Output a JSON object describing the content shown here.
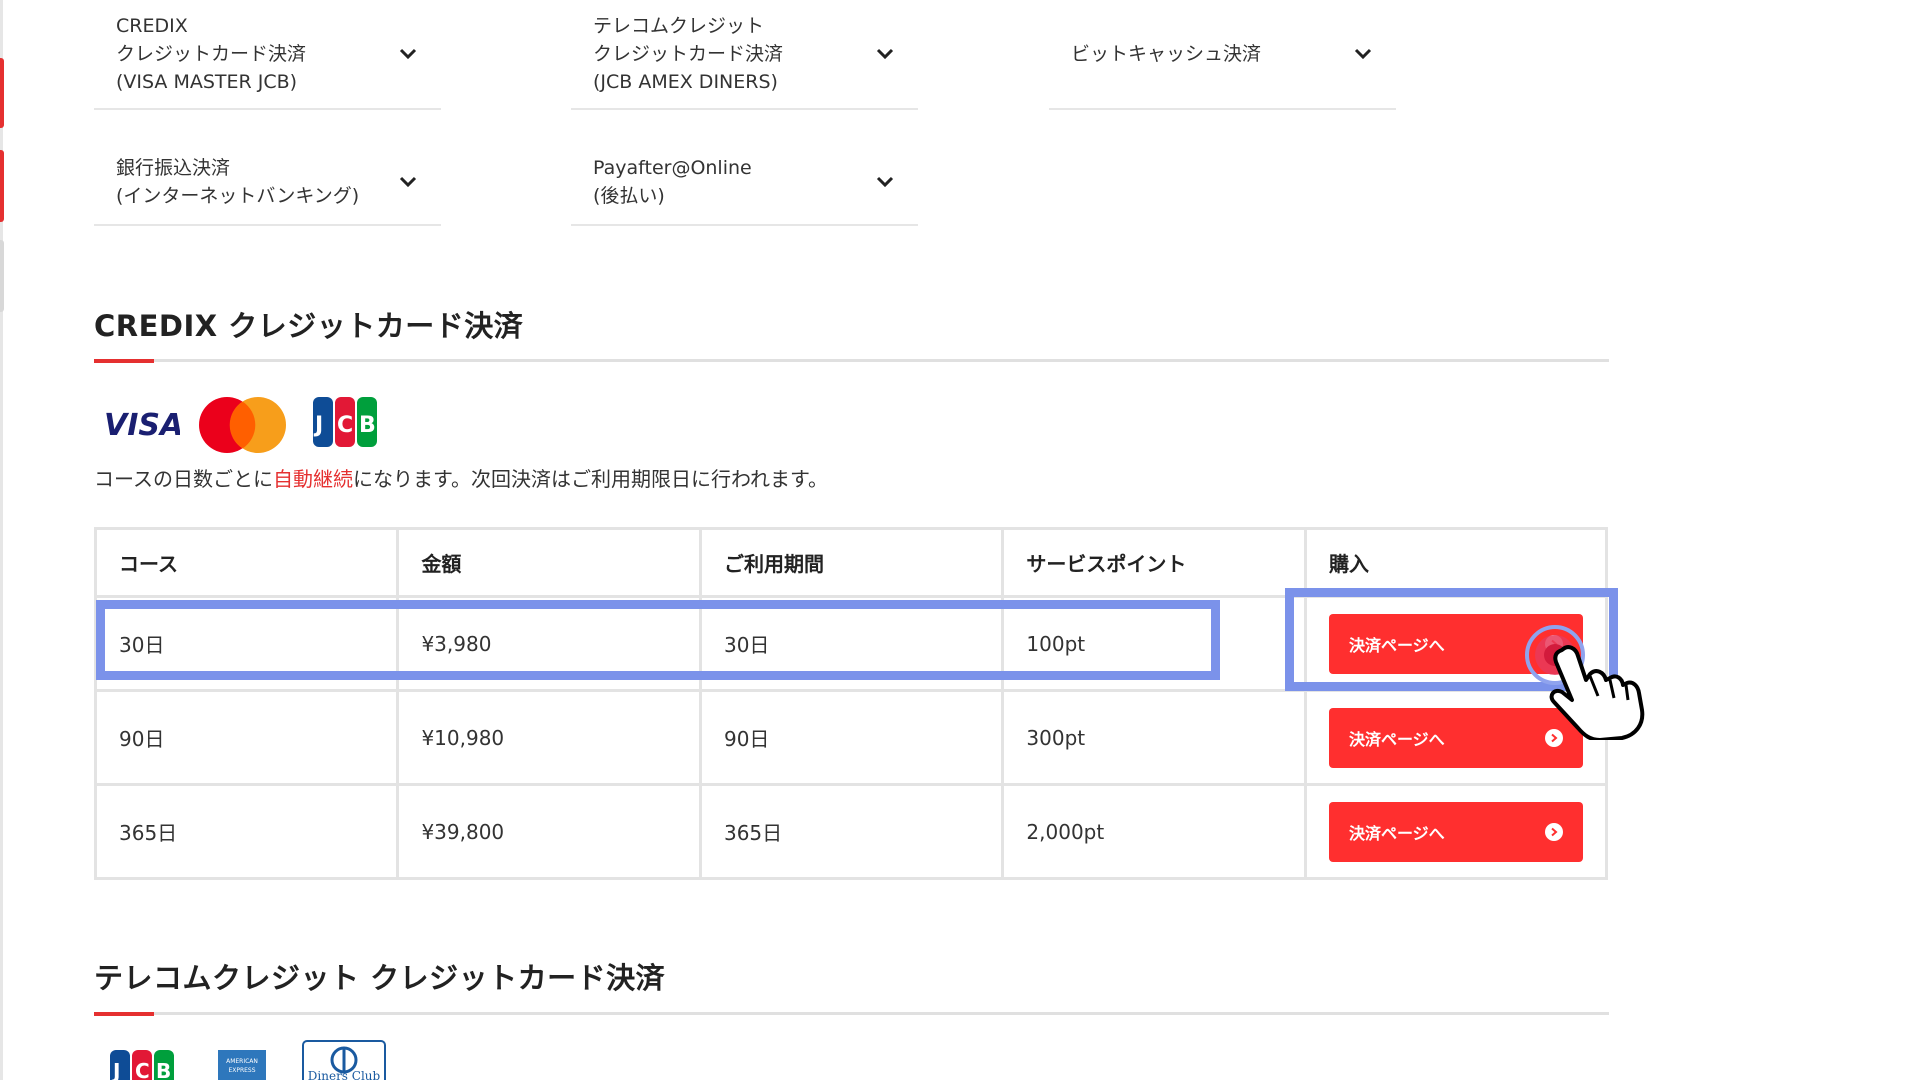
{
  "accordion": [
    {
      "label": "CREDIX\nクレジットカード決済\n(VISA MASTER JCB)"
    },
    {
      "label": "テレコムクレジット\nクレジットカード決済\n(JCB AMEX DINERS)"
    },
    {
      "label": "ビットキャッシュ決済"
    },
    {
      "label": "銀行振込決済\n(インターネットバンキング)"
    },
    {
      "label": "Payafter@Online\n(後払い)"
    }
  ],
  "credix": {
    "title": "CREDIX クレジットカード決済",
    "logos": [
      "VISA",
      "Mastercard",
      "JCB"
    ],
    "note_before": "コースの日数ごとに",
    "note_highlight": "自動継続",
    "note_after": "になります。次回決済はご利用期限日に行われます。",
    "table": {
      "headers": [
        "コース",
        "金額",
        "ご利用期間",
        "サービスポイント",
        "購入"
      ],
      "rows": [
        {
          "course": "30日",
          "price": "¥3,980",
          "period": "30日",
          "points": "100pt",
          "button": "決済ページへ"
        },
        {
          "course": "90日",
          "price": "¥10,980",
          "period": "90日",
          "points": "300pt",
          "button": "決済ページへ"
        },
        {
          "course": "365日",
          "price": "¥39,800",
          "period": "365日",
          "points": "2,000pt",
          "button": "決済ページへ"
        }
      ]
    }
  },
  "telecom": {
    "title": "テレコムクレジット クレジットカード決済",
    "logos": [
      "JCB",
      "AMERICAN EXPRESS",
      "Diners Club"
    ]
  },
  "colors": {
    "accent": "#e53030",
    "button": "#ff2f2f",
    "highlight": "#7b92ea"
  }
}
